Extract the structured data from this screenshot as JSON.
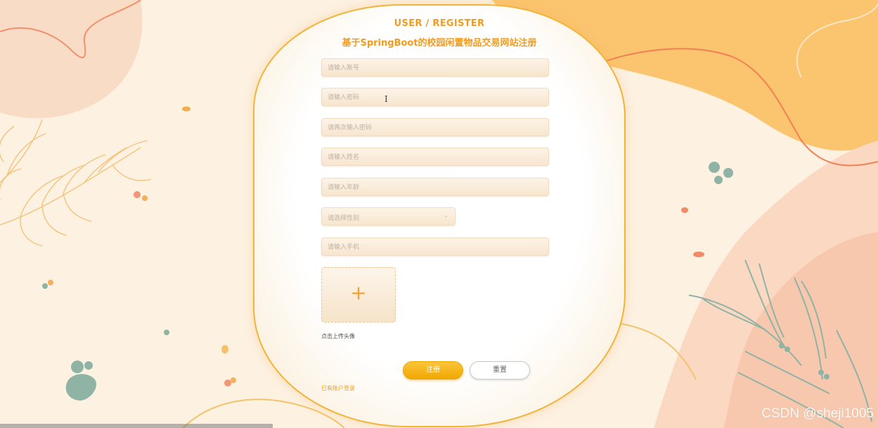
{
  "header": {
    "title_en": "USER / REGISTER",
    "title_cn": "基于SpringBoot的校园闲置物品交易网站注册"
  },
  "form": {
    "account_placeholder": "请输入账号",
    "password_placeholder": "请输入密码",
    "confirm_password_placeholder": "请再次输入密码",
    "name_placeholder": "请输入姓名",
    "age_placeholder": "请输入年龄",
    "gender_select_placeholder": "请选择性别",
    "phone_placeholder": "请输入手机"
  },
  "avatar_upload": {
    "plus_symbol": "+",
    "label": "点击上传头像"
  },
  "actions": {
    "register_label": "注册",
    "reset_label": "重置",
    "login_link_label": "已有账户登录"
  },
  "watermark": "CSDN @sheji1005",
  "icons": {
    "gender_dropdown": "chevron-down-icon",
    "text_cursor": "text-cursor-icon",
    "upload": "plus-icon"
  },
  "colors": {
    "accent": "#f29b1d",
    "button_primary": "#f5b51c",
    "background": "#fdf1e2",
    "leaf_green": "#8fb3a4"
  }
}
